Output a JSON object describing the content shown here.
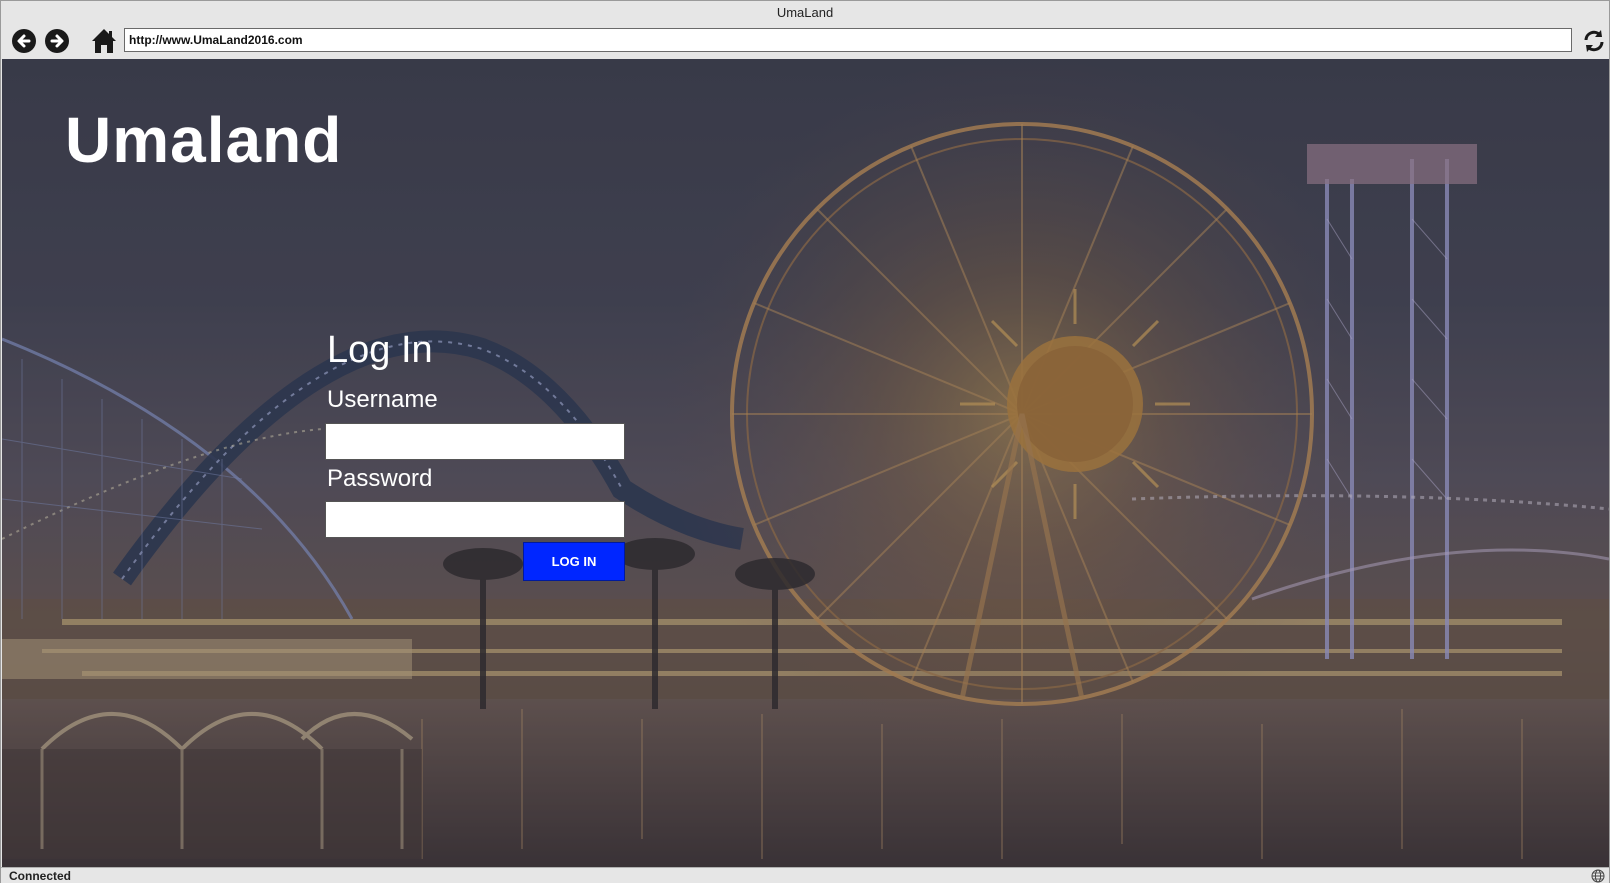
{
  "window": {
    "title": "UmaLand"
  },
  "browser": {
    "url": "http://www.UmaLand2016.com",
    "icons": {
      "back": "arrow-left-circle-icon",
      "forward": "arrow-right-circle-icon",
      "home": "home-icon",
      "refresh": "refresh-icon",
      "status": "globe-icon"
    },
    "status": "Connected"
  },
  "page": {
    "site_title": "Umaland",
    "login": {
      "heading": "Log In",
      "username_label": "Username",
      "username_value": "",
      "password_label": "Password",
      "password_value": "",
      "submit_label": "LOG IN"
    },
    "colors": {
      "button_bg": "#0026ff",
      "text": "#ffffff"
    }
  }
}
